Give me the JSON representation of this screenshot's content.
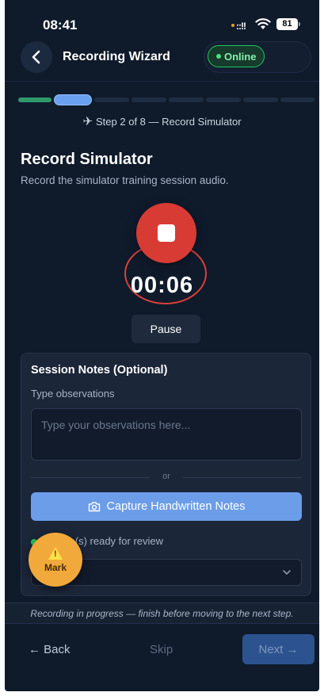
{
  "status_bar": {
    "time": "08:41",
    "signal": "::!!",
    "battery": "81"
  },
  "header": {
    "back_label": "Back",
    "title": "Recording Wizard",
    "connection": "Online"
  },
  "progress": {
    "current_step": 2,
    "total_steps": 8,
    "step_text": "Step 2 of 8 — Record Simulator",
    "colors": {
      "done": "#2e9a6b",
      "current": "#6aa0f0",
      "pending": "#1f2d42"
    }
  },
  "section": {
    "title": "Record Simulator",
    "subtitle": "Record the simulator training session audio."
  },
  "recorder": {
    "elapsed": "00:06",
    "pause_label": "Pause",
    "record_color": "#d83b34"
  },
  "notes": {
    "title": "Session Notes (Optional)",
    "label": "Type observations",
    "placeholder": "Type your observations here...",
    "value": "",
    "divider": "or",
    "capture_label": "Capture Handwritten Notes",
    "ready_text": "1 page(s) ready for review",
    "select_value": ""
  },
  "mark": {
    "label": "Mark"
  },
  "footer": {
    "warning": "Recording in progress — finish before moving to the next step.",
    "back_label": "← Back",
    "skip_label": "Skip",
    "next_label": "Next →"
  },
  "icons": [
    "chevron-left-icon",
    "airplane-icon",
    "stop-icon",
    "camera-icon",
    "chevron-down-icon",
    "warning-icon",
    "wifi-icon",
    "battery-icon"
  ]
}
